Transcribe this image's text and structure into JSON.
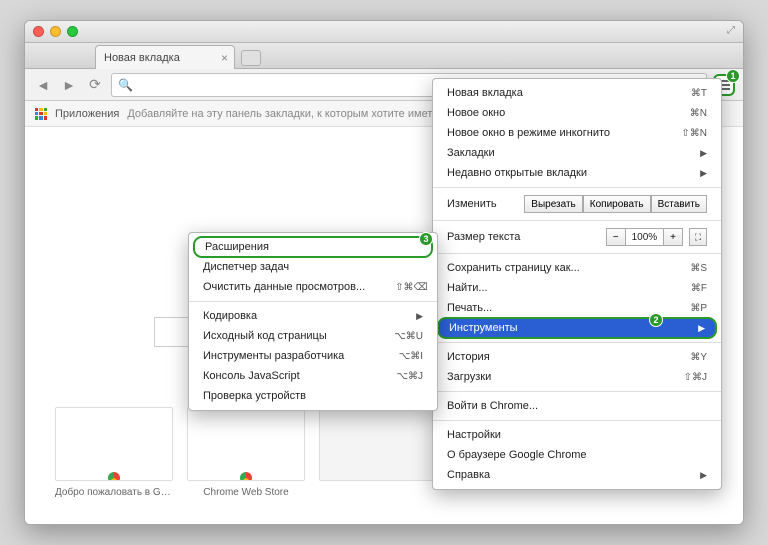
{
  "tab": {
    "title": "Новая вкладка"
  },
  "bookmarks": {
    "apps": "Приложения",
    "hint": "Добавляйте на эту панель закладки, к которым хотите иметь быстрый дос"
  },
  "search": {
    "placeholder": ""
  },
  "thumbs": [
    {
      "caption": "Добро пожаловать в Go..."
    },
    {
      "caption": "Chrome Web Store"
    },
    {
      "caption": ""
    },
    {
      "caption": ""
    },
    {
      "caption": ""
    }
  ],
  "menu": {
    "new_tab": "Новая вкладка",
    "new_tab_sc": "⌘T",
    "new_window": "Новое окно",
    "new_window_sc": "⌘N",
    "incognito": "Новое окно в режиме инкогнито",
    "incognito_sc": "⇧⌘N",
    "bookmarks": "Закладки",
    "recent": "Недавно открытые вкладки",
    "edit": "Изменить",
    "cut": "Вырезать",
    "copy": "Копировать",
    "paste": "Вставить",
    "zoom": "Размер текста",
    "zoom_val": "100%",
    "save": "Сохранить страницу как...",
    "save_sc": "⌘S",
    "find": "Найти...",
    "find_sc": "⌘F",
    "print": "Печать...",
    "print_sc": "⌘P",
    "tools": "Инструменты",
    "history": "История",
    "history_sc": "⌘Y",
    "downloads": "Загрузки",
    "downloads_sc": "⇧⌘J",
    "signin": "Войти в Chrome...",
    "settings": "Настройки",
    "about": "О браузере Google Chrome",
    "help": "Справка"
  },
  "submenu": {
    "extensions": "Расширения",
    "taskmgr": "Диспетчер задач",
    "clear": "Очистить данные просмотров...",
    "clear_sc": "⇧⌘⌫",
    "encoding": "Кодировка",
    "source": "Исходный код страницы",
    "source_sc": "⌥⌘U",
    "devtools": "Инструменты разработчика",
    "devtools_sc": "⌥⌘I",
    "console": "Консоль JavaScript",
    "console_sc": "⌥⌘J",
    "inspect": "Проверка устройств"
  },
  "badges": {
    "hamburger": "1",
    "tools": "2",
    "extensions": "3"
  }
}
